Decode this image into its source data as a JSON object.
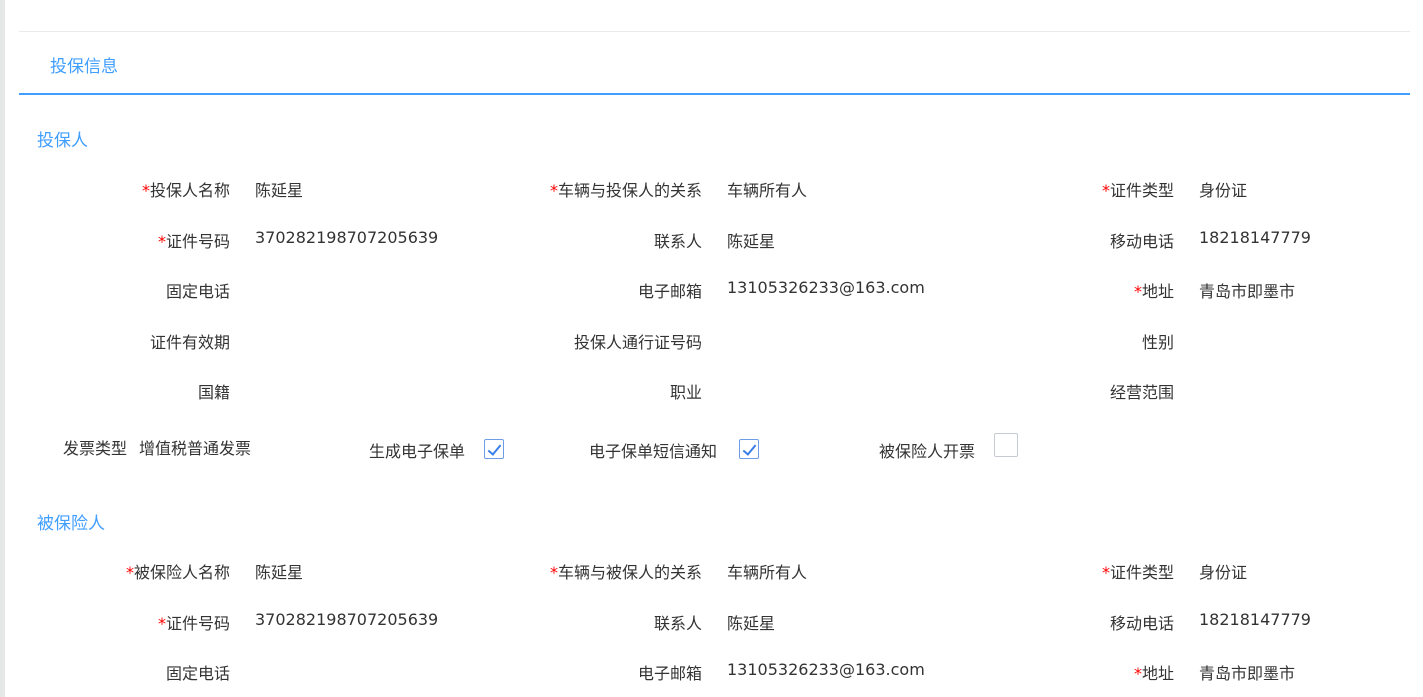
{
  "tab": "投保信息",
  "applicant": {
    "title": "投保人",
    "rows": [
      [
        {
          "label": "投保人名称",
          "required": true,
          "value": "陈延星"
        },
        {
          "label": "车辆与投保人的关系",
          "required": true,
          "value": "车辆所有人"
        },
        {
          "label": "证件类型",
          "required": true,
          "value": "身份证"
        }
      ],
      [
        {
          "label": "证件号码",
          "required": true,
          "value": "370282198707205639"
        },
        {
          "label": "联系人",
          "required": false,
          "value": "陈延星"
        },
        {
          "label": "移动电话",
          "required": false,
          "value": "18218147779"
        }
      ],
      [
        {
          "label": "固定电话",
          "required": false,
          "value": ""
        },
        {
          "label": "电子邮箱",
          "required": false,
          "value": "13105326233@163.com"
        },
        {
          "label": "地址",
          "required": true,
          "value": "青岛市即墨市"
        }
      ],
      [
        {
          "label": "证件有效期",
          "required": false,
          "value": ""
        },
        {
          "label": "投保人通行证号码",
          "required": false,
          "value": ""
        },
        {
          "label": "性别",
          "required": false,
          "value": ""
        }
      ],
      [
        {
          "label": "国籍",
          "required": false,
          "value": ""
        },
        {
          "label": "职业",
          "required": false,
          "value": ""
        },
        {
          "label": "经营范围",
          "required": false,
          "value": ""
        }
      ]
    ],
    "invoice_label": "发票类型",
    "invoice_value": "增值税普通发票",
    "e_policy_label": "生成电子保单",
    "e_policy_checked": true,
    "sms_label": "电子保单短信通知",
    "sms_checked": true,
    "insured_invoice_label": "被保险人开票",
    "insured_invoice_checked": false
  },
  "insured": {
    "title": "被保险人",
    "rows": [
      [
        {
          "label": "被保险人名称",
          "required": true,
          "value": "陈延星"
        },
        {
          "label": "车辆与被保人的关系",
          "required": true,
          "value": "车辆所有人"
        },
        {
          "label": "证件类型",
          "required": true,
          "value": "身份证"
        }
      ],
      [
        {
          "label": "证件号码",
          "required": true,
          "value": "370282198707205639"
        },
        {
          "label": "联系人",
          "required": false,
          "value": "陈延星"
        },
        {
          "label": "移动电话",
          "required": false,
          "value": "18218147779"
        }
      ],
      [
        {
          "label": "固定电话",
          "required": false,
          "value": ""
        },
        {
          "label": "电子邮箱",
          "required": false,
          "value": "13105326233@163.com"
        },
        {
          "label": "地址",
          "required": true,
          "value": "青岛市即墨市"
        }
      ]
    ]
  },
  "req_mark": "*"
}
